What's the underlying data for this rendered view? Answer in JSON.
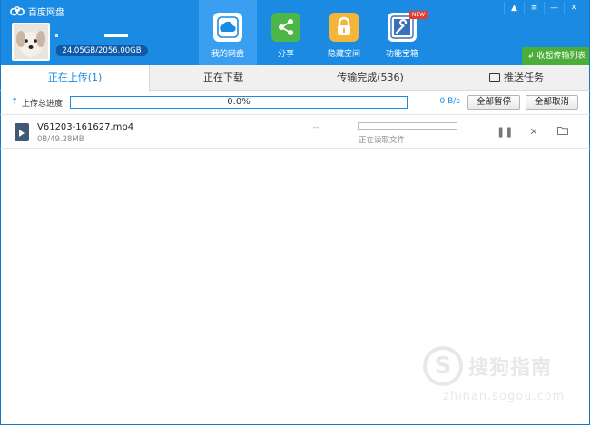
{
  "app": {
    "title": "百度网盘"
  },
  "user": {
    "quota": "24.05GB/2056.00GB",
    "quota_fraction": 0.0117
  },
  "nav": [
    {
      "label": "我的网盘",
      "icon": "cloud-icon",
      "active": true
    },
    {
      "label": "分享",
      "icon": "share-icon",
      "active": false
    },
    {
      "label": "隐藏空间",
      "icon": "lock-icon",
      "active": false
    },
    {
      "label": "功能宝箱",
      "icon": "toolbox-icon",
      "active": false,
      "badge": "NEW"
    }
  ],
  "window_controls": [
    "▲",
    "≡",
    "—",
    "✕"
  ],
  "collapse_button": "收起传输列表",
  "tabs": [
    {
      "label": "正在上传(1)",
      "active": true
    },
    {
      "label": "正在下载",
      "active": false
    },
    {
      "label": "传输完成(536)",
      "active": false
    },
    {
      "label": "推送任务",
      "active": false
    }
  ],
  "total_progress": {
    "label": "上传总进度",
    "percent_text": "0.0%",
    "speed": "0 B/s",
    "pause_all": "全部暂停",
    "cancel_all": "全部取消"
  },
  "files": [
    {
      "name": "V61203-161627.mp4",
      "size": "0B/49.28MB",
      "remaining": "--",
      "status": "正在读取文件",
      "progress": 0
    }
  ],
  "watermark": {
    "logo_char": "S",
    "text": "搜狗指南",
    "url": "zhinan.sogou.com"
  },
  "colors": {
    "brand_blue": "#1a8ae2",
    "green": "#4cae3a",
    "share_green": "#4cb648",
    "lock_yellow": "#f4b53a",
    "badge_red": "#e53d30"
  }
}
